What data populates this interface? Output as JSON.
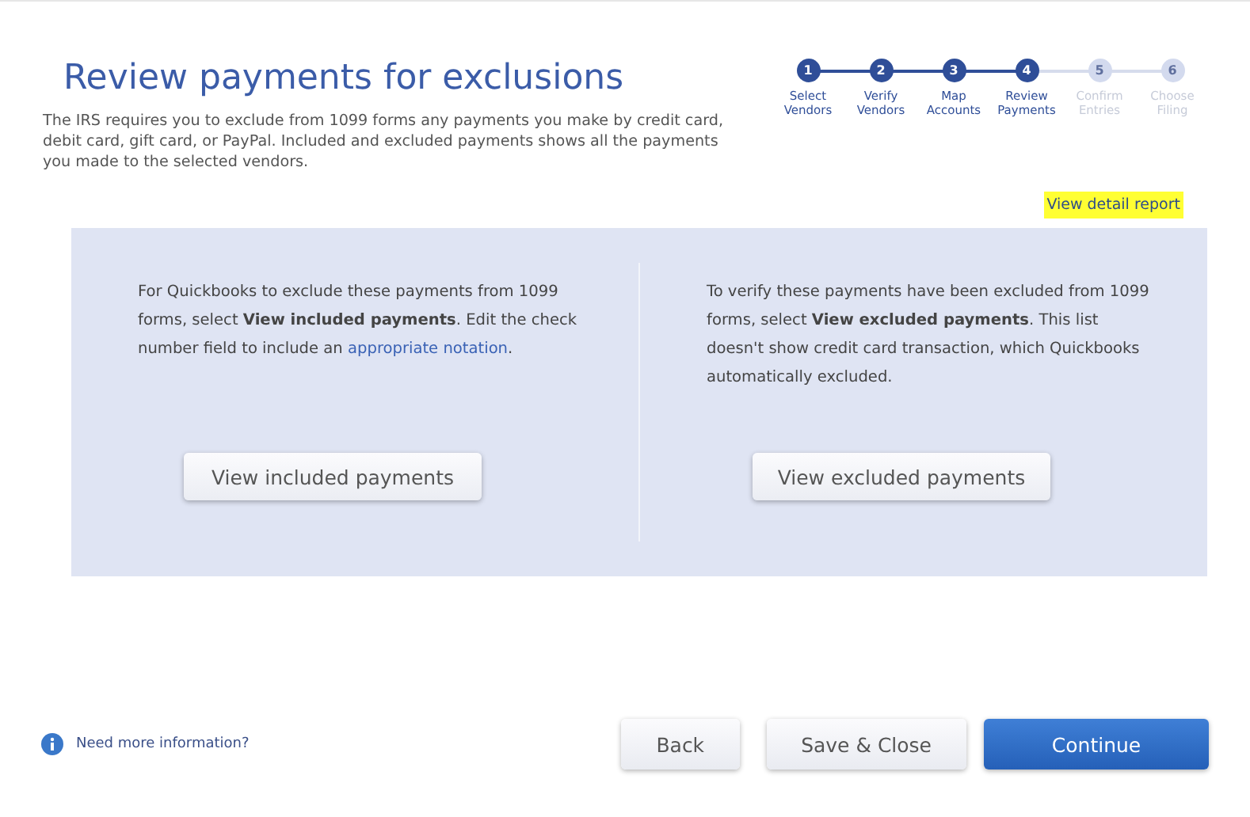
{
  "title": "Review payments for exclusions",
  "intro": "The IRS requires you to exclude from 1099 forms any payments you make by credit card, debit card, gift card, or PayPal. Included and excluded payments shows all the payments you made to the selected vendors.",
  "steps": [
    {
      "number": "1",
      "label": "Select Vendors",
      "disabled": false
    },
    {
      "number": "2",
      "label": "Verify Vendors",
      "disabled": false
    },
    {
      "number": "3",
      "label": "Map Accounts",
      "disabled": false
    },
    {
      "number": "4",
      "label": "Review Payments",
      "disabled": false
    },
    {
      "number": "5",
      "label": "Confirm Entries",
      "disabled": true
    },
    {
      "number": "6",
      "label": "Choose Filing",
      "disabled": true
    }
  ],
  "report_link": {
    "label": "View detail report",
    "highlighted": true
  },
  "panels": [
    {
      "text": "For Quickbooks to exclude these payments from 1099 forms, select **View included payments**. Edit the check number field to include an ",
      "link": "appropriate notation",
      "text_after": ".",
      "button": "View included payments"
    },
    {
      "text": "To verify these payments have been excluded from 1099 forms, select **View excluded payments**. This list doesn't show credit card transaction, which Quickbooks automatically excluded.",
      "button": "View excluded payments"
    }
  ],
  "help_link": "Need more information?",
  "buttons": [
    {
      "label": "Back",
      "kind": "secondary"
    },
    {
      "label": "Save & Close",
      "kind": "secondary"
    },
    {
      "label": "Continue",
      "kind": "primary"
    }
  ]
}
